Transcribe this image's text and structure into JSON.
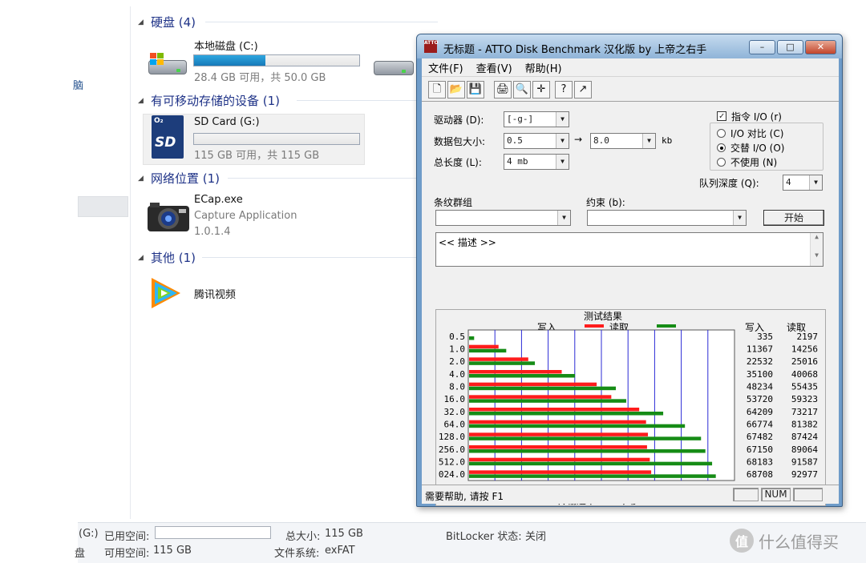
{
  "explorer": {
    "left_nav_mark": "脑",
    "groups": [
      {
        "label": "硬盘 (4)"
      },
      {
        "label": "有可移动存储的设备 (1)"
      },
      {
        "label": "网络位置 (1)"
      },
      {
        "label": "其他 (1)"
      }
    ],
    "local_disk": {
      "name": "本地磁盘 (C:)",
      "space": "28.4 GB 可用，共 50.0 GB",
      "used_fraction": 0.43
    },
    "sd_card": {
      "name": "SD Card (G:)",
      "space": "115 GB 可用，共 115 GB",
      "used_fraction": 0.0,
      "icon_text": "SD",
      "icon_badge": "O₂"
    },
    "ecap": {
      "name": "ECap.exe",
      "description": "Capture Application",
      "version": "1.0.1.4"
    },
    "tencent": {
      "name": "腾讯视频"
    },
    "status": {
      "drive_letter": "(G:)",
      "used_label": "已用空间:",
      "total_label": "总大小:",
      "total_value": "115 GB",
      "bitlocker_label": "BitLocker 状态:",
      "bitlocker_value": "关闭",
      "prefix_char": "盘",
      "free_label": "可用空间:",
      "free_value": "115 GB",
      "fs_label": "文件系统:",
      "fs_value": "exFAT"
    },
    "watermark": {
      "logo": "值",
      "text": "什么值得买"
    }
  },
  "atto": {
    "title": "无标题 - ATTO Disk Benchmark  汉化版 by 上帝之右手",
    "logo_text": "ATTO",
    "window_buttons": {
      "minimize": "–",
      "maximize": "□",
      "close": "✕"
    },
    "menu": [
      "文件(F)",
      "查看(V)",
      "帮助(H)"
    ],
    "toolbar_icons": [
      "new-icon",
      "open-icon",
      "save-icon",
      "print-icon",
      "preview-icon",
      "move-icon",
      "help-icon",
      "context-help-icon"
    ],
    "toolbar_glyphs": [
      "🗋",
      "📂",
      "💾",
      "🖨",
      "🔍",
      "✛",
      "?",
      "↗"
    ],
    "form": {
      "drive_label": "驱动器 (D):",
      "drive_value": "[-g-]",
      "packet_label": "数据包大小:",
      "packet_from": "0.5",
      "arrow": "→",
      "packet_to": "8.0",
      "packet_unit": "kb",
      "length_label": "总长度 (L):",
      "length_value": "4 mb",
      "direct_io_label": "指令 I/O (r)",
      "radio_compare": "I/O 对比 (C)",
      "radio_overlap": "交替 I/O (O)",
      "radio_none": "不使用 (N)",
      "queue_label": "队列深度 (Q):",
      "queue_value": "4",
      "stripe_label": "条纹群组",
      "stripe_value": "",
      "constraint_label": "约束 (b):",
      "constraint_value": "",
      "start_button": "开始",
      "description": "<< 描述 >>"
    },
    "status_text": "需要帮助, 请按 F1",
    "status_num": "NUM"
  },
  "chart_data": {
    "type": "bar",
    "orientation": "horizontal",
    "title": "测试结果",
    "xlabel": "传输速率 - MB / 秒",
    "xlim": [
      0,
      100
    ],
    "xticks": [
      "0",
      "10",
      "20",
      "30",
      "40",
      "50",
      "60",
      "70",
      "80",
      "90",
      "100"
    ],
    "categories": [
      "0.5",
      "1.0",
      "2.0",
      "4.0",
      "8.0",
      "16.0",
      "32.0",
      "64.0",
      "128.0",
      "256.0",
      "512.0",
      "024.0"
    ],
    "series": [
      {
        "name": "写入",
        "color": "#ff1c1c",
        "values": [
          0.335,
          11.367,
          22.532,
          35.1,
          48.234,
          53.72,
          64.209,
          66.774,
          67.482,
          67.15,
          68.183,
          68.708
        ],
        "labels": [
          "335",
          "11367",
          "22532",
          "35100",
          "48234",
          "53720",
          "64209",
          "66774",
          "67482",
          "67150",
          "68183",
          "68708"
        ]
      },
      {
        "name": "读取",
        "color": "#168c16",
        "values": [
          2.197,
          14.256,
          25.016,
          40.068,
          55.435,
          59.323,
          73.217,
          81.382,
          87.424,
          89.064,
          91.587,
          92.977
        ],
        "labels": [
          "2197",
          "14256",
          "25016",
          "40068",
          "55435",
          "59323",
          "73217",
          "81382",
          "87424",
          "89064",
          "91587",
          "92977"
        ]
      }
    ],
    "grid": true,
    "legend_position": "top"
  }
}
